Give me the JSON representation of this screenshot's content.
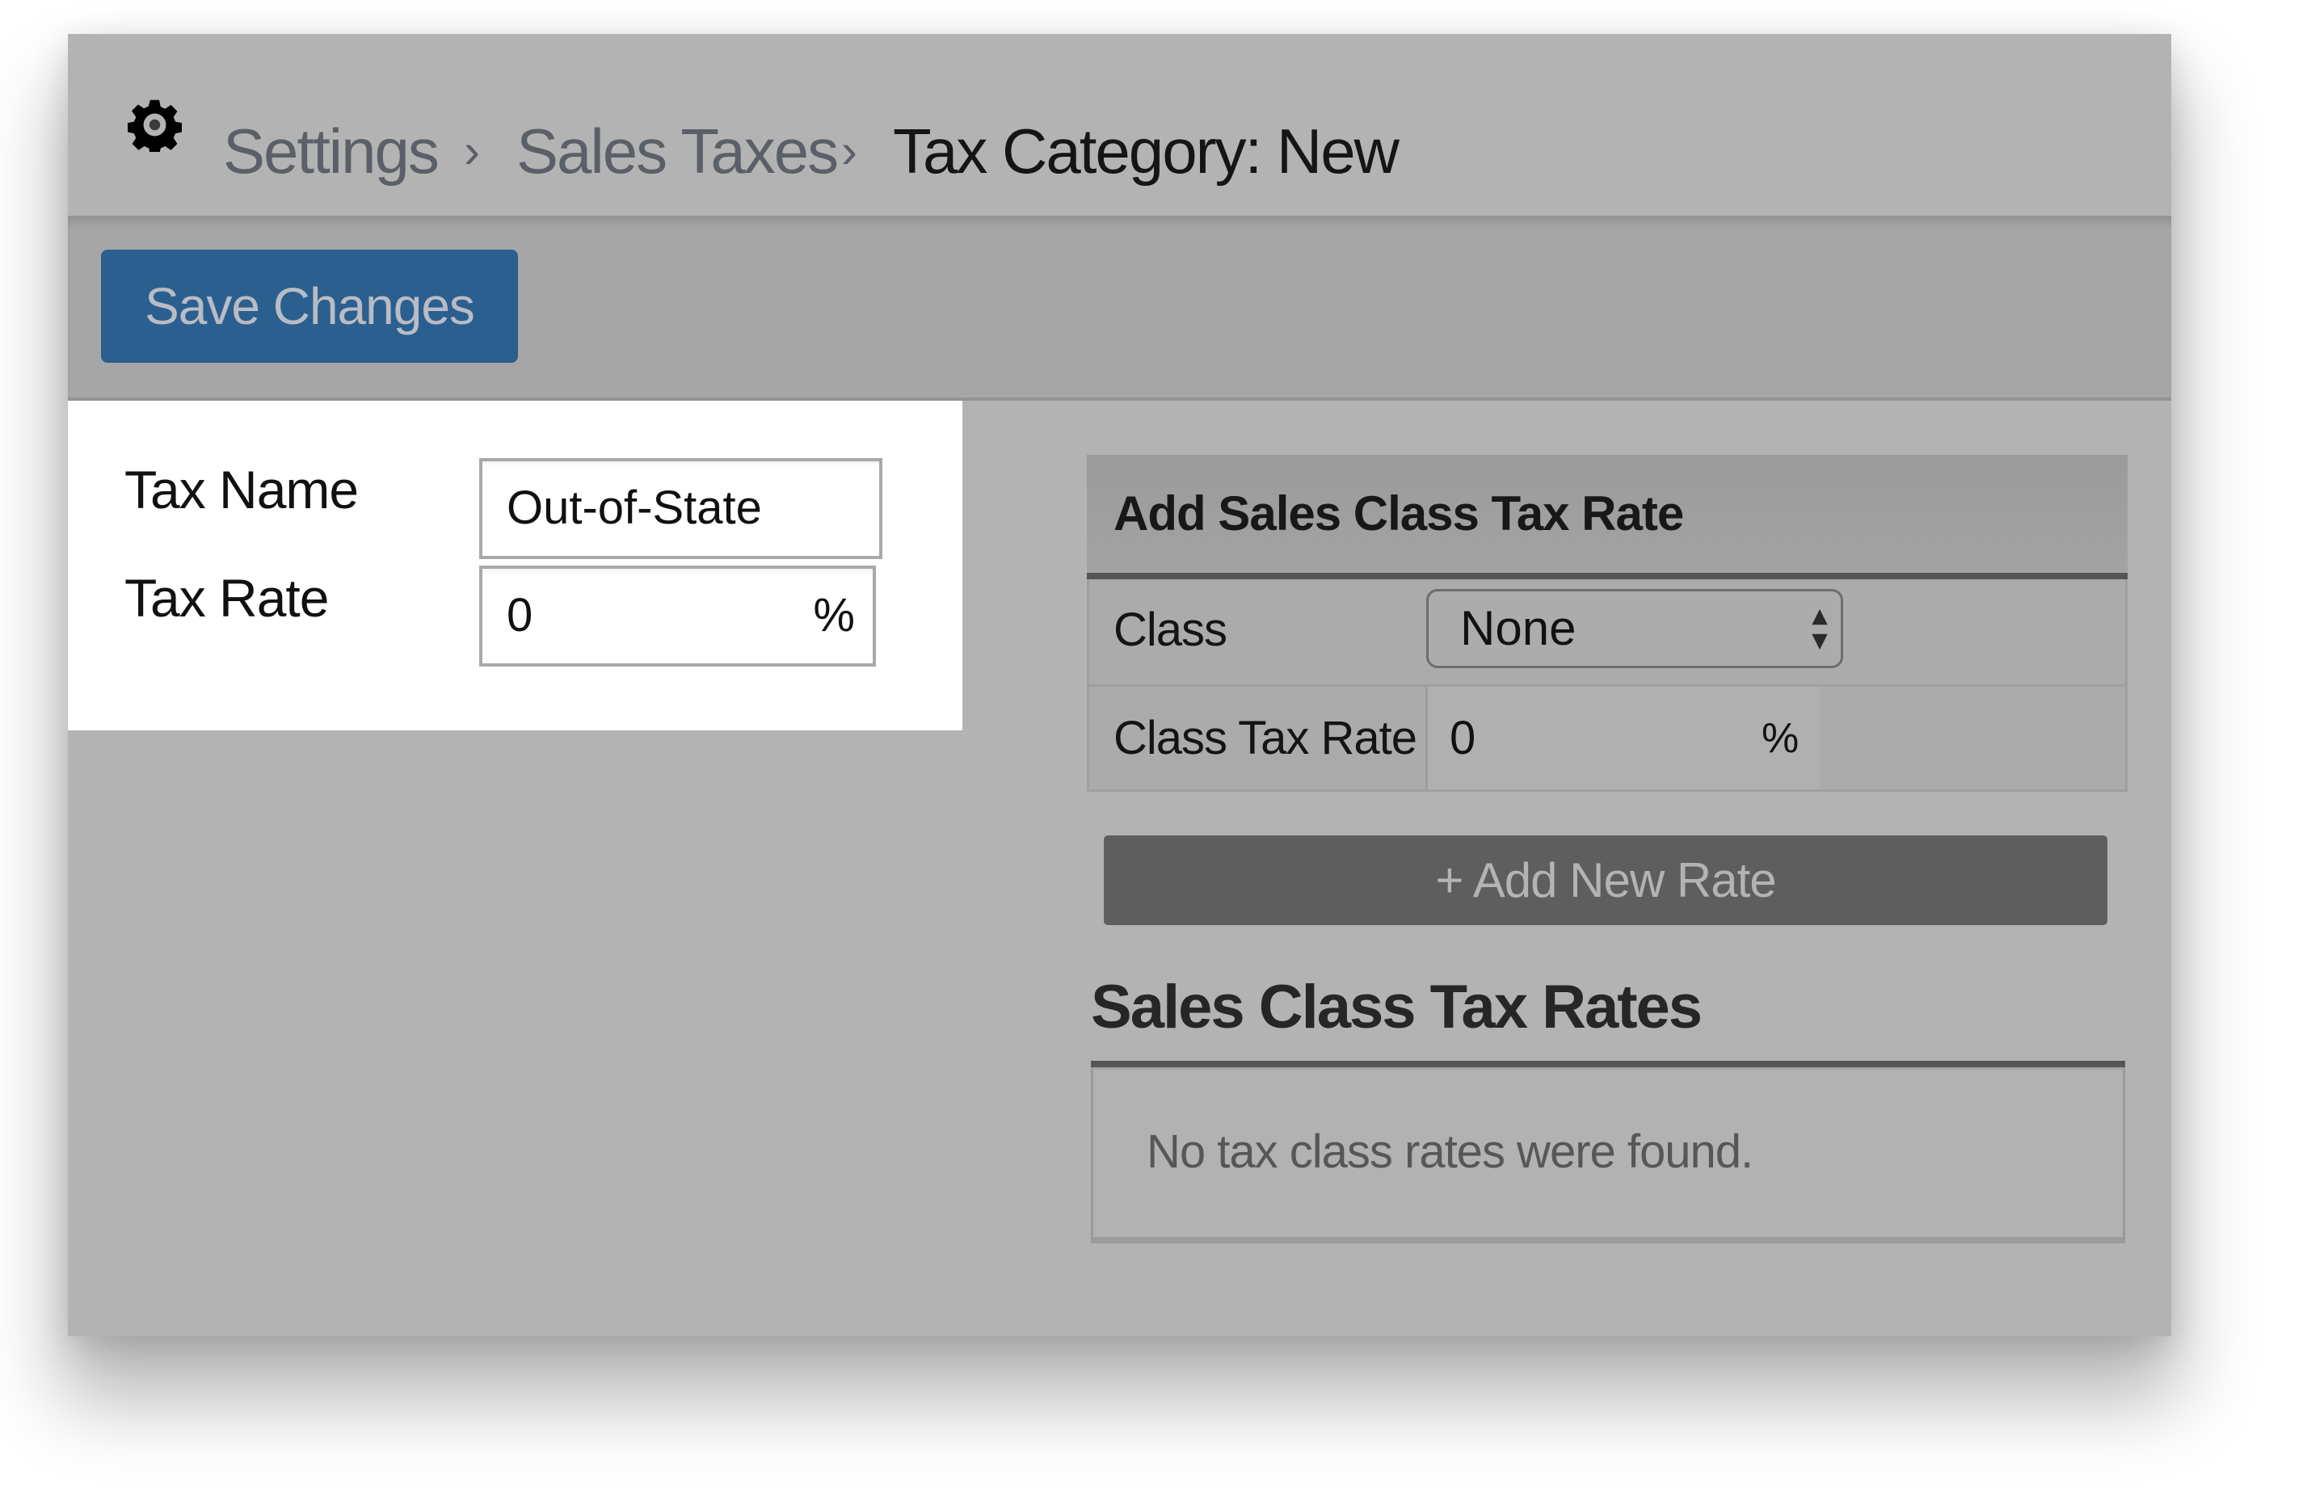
{
  "breadcrumb": {
    "icon": "gear-icon",
    "items": [
      "Settings",
      "Sales Taxes"
    ],
    "separator": "›",
    "current": "Tax Category: New"
  },
  "toolbar": {
    "save_label": "Save Changes"
  },
  "form": {
    "tax_name": {
      "label": "Tax Name",
      "value": "Out-of-State"
    },
    "tax_rate": {
      "label": "Tax Rate",
      "value": "0",
      "suffix": "%"
    }
  },
  "add_rate": {
    "title": "Add Sales Class Tax Rate",
    "class_label": "Class",
    "class_value": "None",
    "rate_label": "Class Tax Rate",
    "rate_value": "0",
    "rate_suffix": "%",
    "add_button": "+ Add New Rate"
  },
  "rates": {
    "heading": "Sales Class Tax Rates",
    "empty_message": "No tax class rates were found."
  },
  "colors": {
    "primary_button": "#2b5f8f",
    "secondary_button": "#5e5e5e",
    "panel_bg": "#b3b3b3"
  }
}
